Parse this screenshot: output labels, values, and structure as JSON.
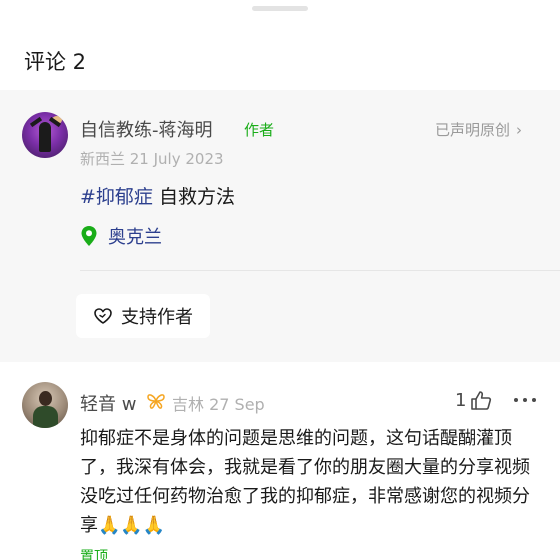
{
  "comments_header": "评论 2",
  "post": {
    "author_name": "自信教练-蒋海明",
    "author_tag": "作者",
    "original_link": "已声明原创",
    "meta": "新西兰 21 July 2023",
    "hashtag": "#抑郁症",
    "body_text": " 自救方法",
    "location": "奥克兰",
    "support_button": "支持作者"
  },
  "comment": {
    "name": "轻音 w",
    "meta": "吉林 27 Sep",
    "like_count": "1",
    "text": "抑郁症不是身体的问题是思维的问题，这句话醍醐灌顶了，我深有体会，我就是看了你的朋友圈大量的分享视频没吃过任何药物治愈了我的抑郁症，非常感谢您的视频分享🙏🙏🙏",
    "pinned": "置顶"
  },
  "colors": {
    "accent_green": "#1aad19",
    "link_blue": "#2c3f8e",
    "muted_gray": "#b0b0b0",
    "card_bg": "#f7f7f7",
    "butterfly_orange": "#f5a623"
  },
  "icons": [
    "chevron-right-icon",
    "location-pin-icon",
    "heart-icon",
    "butterfly-icon",
    "thumbs-up-icon",
    "more-icon"
  ]
}
